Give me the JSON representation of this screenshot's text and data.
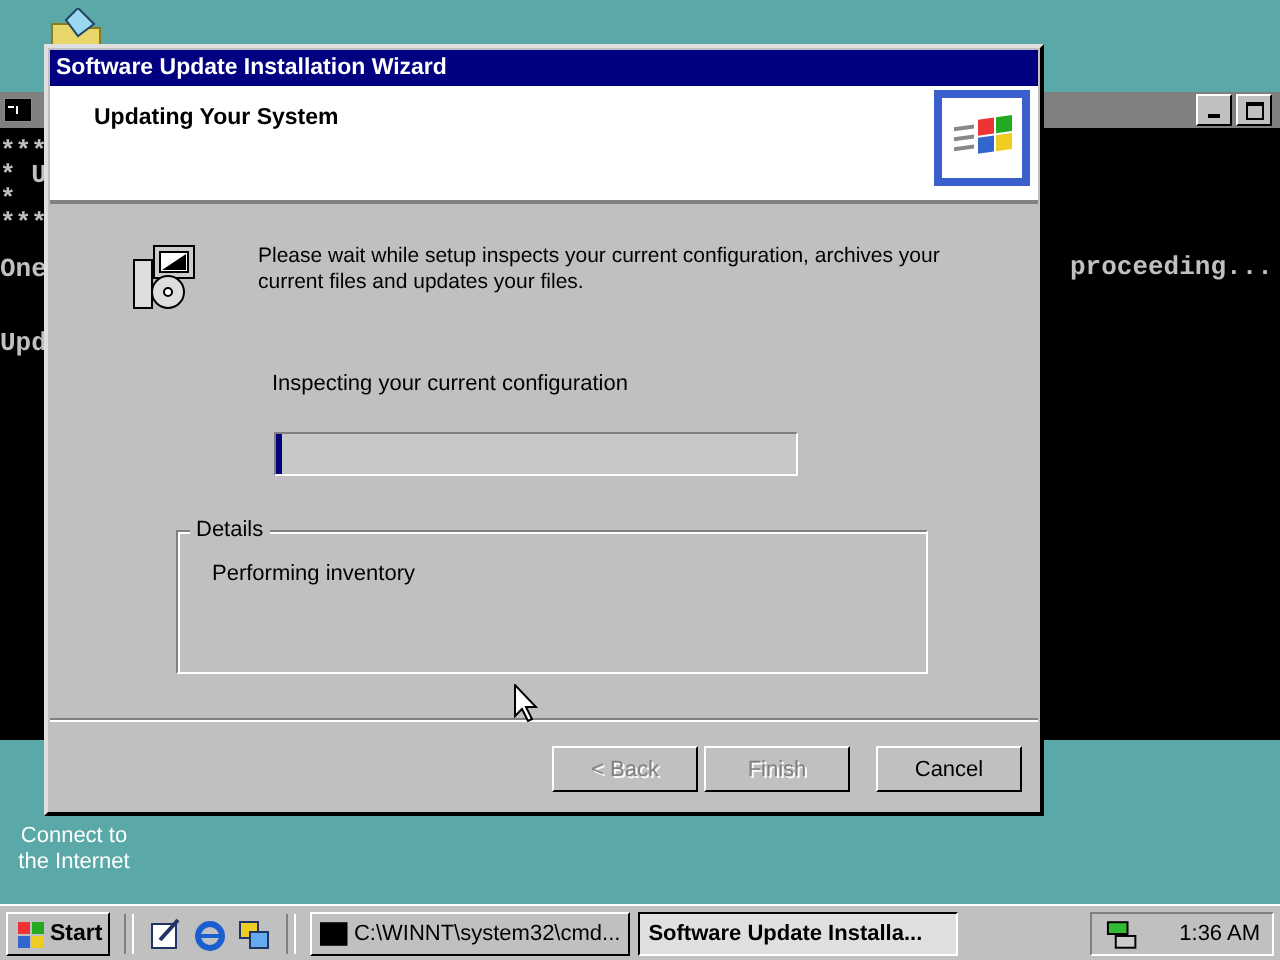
{
  "desktop_icons": [
    {
      "label": "Connect to the Internet"
    }
  ],
  "console": {
    "blocks": [
      [
        "***",
        "* U",
        "*",
        "***"
      ],
      [
        "One"
      ],
      [
        "Upd"
      ]
    ],
    "right_text": "proceeding..."
  },
  "dialog": {
    "title": "Software Update Installation Wizard",
    "heading": "Updating Your System",
    "message": "Please wait while setup inspects your current configuration, archives your current files and updates your files.",
    "status": "Inspecting your current configuration",
    "progress": {
      "level": 0.01
    },
    "details": {
      "label": "Details",
      "text": "Performing inventory"
    },
    "buttons": [
      {
        "label": "< Back",
        "disabled": true
      },
      {
        "label": "Finish",
        "disabled": true
      },
      {
        "label": "Cancel",
        "disabled": false
      }
    ]
  },
  "taskbar": {
    "start": "Start",
    "tasks": [
      {
        "label": "C:\\WINNT\\system32\\cmd...",
        "selected": false
      },
      {
        "label": "Software Update Installa...",
        "selected": true
      }
    ],
    "clock": "1:36 AM"
  }
}
